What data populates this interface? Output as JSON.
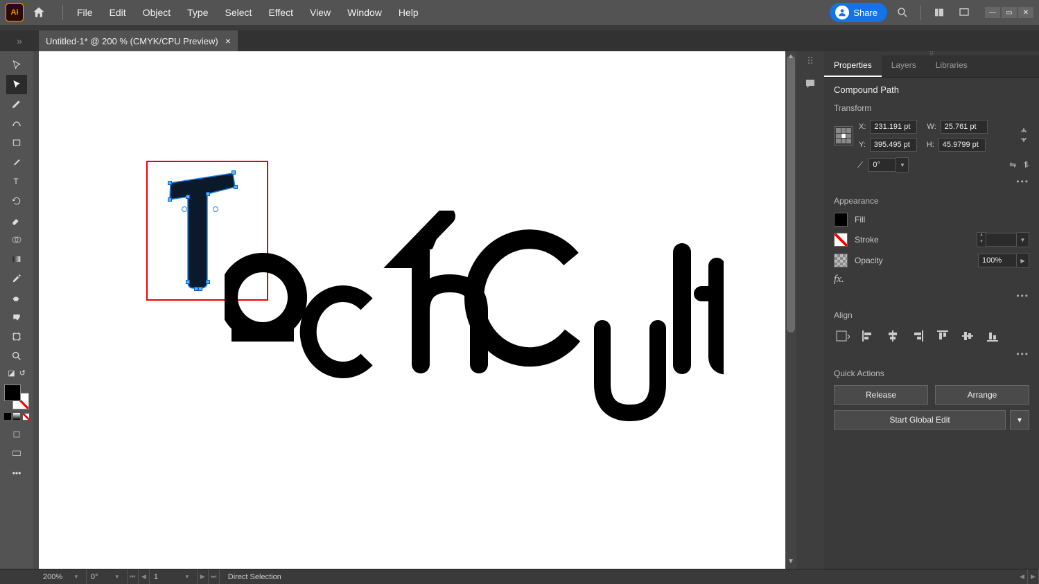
{
  "menubar": {
    "items": [
      "File",
      "Edit",
      "Object",
      "Type",
      "Select",
      "Effect",
      "View",
      "Window",
      "Help"
    ],
    "share": "Share"
  },
  "tab": {
    "title": "Untitled-1* @ 200 % (CMYK/CPU Preview)"
  },
  "canvas": {
    "logo_rest": "echCult",
    "selected_letter": "T"
  },
  "panel": {
    "tabs": [
      "Properties",
      "Layers",
      "Libraries"
    ],
    "selection_type": "Compound Path",
    "transform": {
      "title": "Transform",
      "x_label": "X:",
      "x": "231.191 pt",
      "y_label": "Y:",
      "y": "395.495 pt",
      "w_label": "W:",
      "w": "25.761 pt",
      "h_label": "H:",
      "h": "45.9799 pt",
      "angle_label": "",
      "angle": "0°"
    },
    "appearance": {
      "title": "Appearance",
      "fill_label": "Fill",
      "stroke_label": "Stroke",
      "opacity_label": "Opacity",
      "opacity": "100%"
    },
    "align": {
      "title": "Align"
    },
    "quick": {
      "title": "Quick Actions",
      "release": "Release",
      "arrange": "Arrange",
      "global": "Start Global Edit"
    }
  },
  "statusbar": {
    "zoom": "200%",
    "rotation": "0°",
    "artboard": "1",
    "tool": "Direct Selection"
  }
}
